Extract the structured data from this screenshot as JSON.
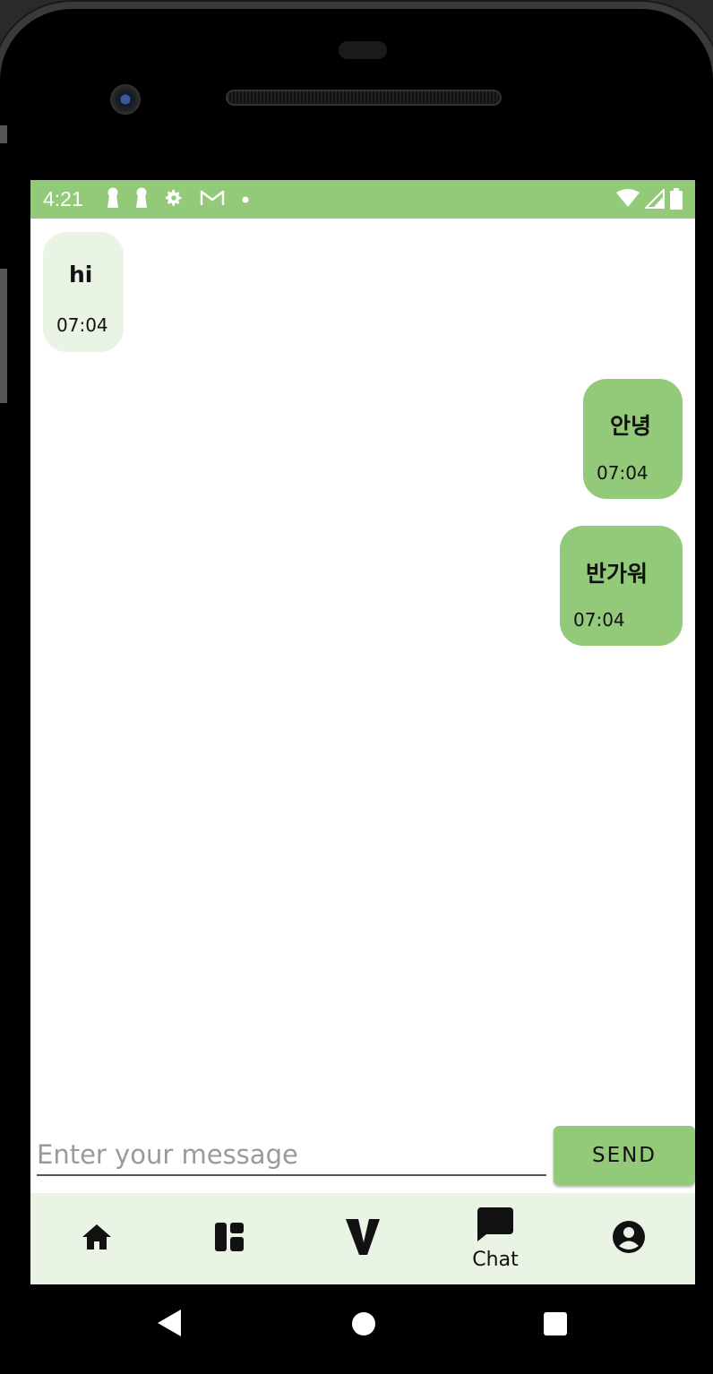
{
  "status_bar": {
    "time": "4:21",
    "left_icons": [
      "keyhole-icon",
      "keyhole-icon",
      "gear-icon",
      "gmail-icon",
      "dot-icon"
    ],
    "right_icons": [
      "wifi-icon",
      "cell-signal-icon",
      "battery-icon"
    ],
    "background": "#93ca79"
  },
  "messages": [
    {
      "direction": "incoming",
      "text": "hi",
      "time": "07:04"
    },
    {
      "direction": "outgoing",
      "text": "안녕",
      "time": "07:04"
    },
    {
      "direction": "outgoing",
      "text": "반가워",
      "time": "07:04"
    }
  ],
  "composer": {
    "placeholder": "Enter your message",
    "value": "",
    "send_label": "SEND"
  },
  "bottom_nav": {
    "items": [
      {
        "icon": "home-icon",
        "label": ""
      },
      {
        "icon": "dashboard-icon",
        "label": ""
      },
      {
        "icon": "v-logo-icon",
        "label": ""
      },
      {
        "icon": "chat-icon",
        "label": "Chat",
        "selected": true
      },
      {
        "icon": "account-icon",
        "label": ""
      }
    ],
    "background": "#eaf4e4"
  },
  "system_nav": {
    "items": [
      "back-icon",
      "home-circle-icon",
      "recents-icon"
    ]
  },
  "colors": {
    "accent": "#93ca79",
    "incoming_bubble": "#eaf4e4",
    "outgoing_bubble": "#93ca79"
  }
}
